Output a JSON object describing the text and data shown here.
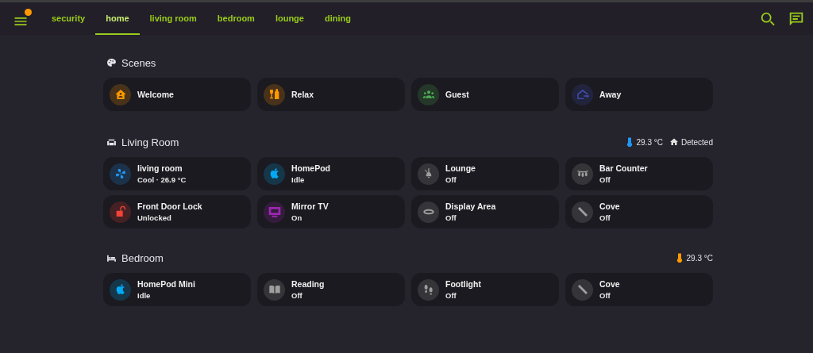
{
  "menu": {
    "notification": true
  },
  "tabs": [
    {
      "label": "security",
      "selected": false
    },
    {
      "label": "home",
      "selected": true
    },
    {
      "label": "living room",
      "selected": false
    },
    {
      "label": "bedroom",
      "selected": false
    },
    {
      "label": "lounge",
      "selected": false
    },
    {
      "label": "dining",
      "selected": false
    }
  ],
  "sections": [
    {
      "kind": "scenes",
      "title": "Scenes",
      "tiles": [
        {
          "name": "Welcome",
          "color": "#ff9800"
        },
        {
          "name": "Relax",
          "color": "#ff9800"
        },
        {
          "name": "Guest",
          "color": "#4caf50"
        },
        {
          "name": "Away",
          "color": "#3f51b5"
        }
      ]
    },
    {
      "kind": "living",
      "title": "Living Room",
      "badges": [
        {
          "kind": "temperature",
          "text": "29.3 °C",
          "color": "#2196f3"
        },
        {
          "kind": "presence",
          "text": "Detected",
          "color": "#e1e1e1"
        }
      ],
      "tiles": [
        {
          "name": "living room",
          "state": "Cool · 26.9 °C",
          "color": "#2196f3"
        },
        {
          "name": "HomePod",
          "state": "Idle",
          "color": "#03a9f4"
        },
        {
          "name": "Lounge",
          "state": "Off",
          "color": "#9e9e9e"
        },
        {
          "name": "Bar Counter",
          "state": "Off",
          "color": "#9e9e9e"
        },
        {
          "name": "Front Door Lock",
          "state": "Unlocked",
          "color": "#f44336"
        },
        {
          "name": "Mirror TV",
          "state": "On",
          "color": "#9c27b0"
        },
        {
          "name": "Display Area",
          "state": "Off",
          "color": "#9e9e9e"
        },
        {
          "name": "Cove",
          "state": "Off",
          "color": "#9e9e9e"
        }
      ]
    },
    {
      "kind": "bedroom",
      "title": "Bedroom",
      "badges": [
        {
          "kind": "temperature",
          "text": "29.3 °C",
          "color": "#ff9800"
        }
      ],
      "tiles": [
        {
          "name": "HomePod Mini",
          "state": "Idle",
          "color": "#03a9f4"
        },
        {
          "name": "Reading",
          "state": "Off",
          "color": "#9e9e9e"
        },
        {
          "name": "Footlight",
          "state": "Off",
          "color": "#9e9e9e"
        },
        {
          "name": "Cove",
          "state": "Off",
          "color": "#9e9e9e"
        }
      ]
    }
  ]
}
